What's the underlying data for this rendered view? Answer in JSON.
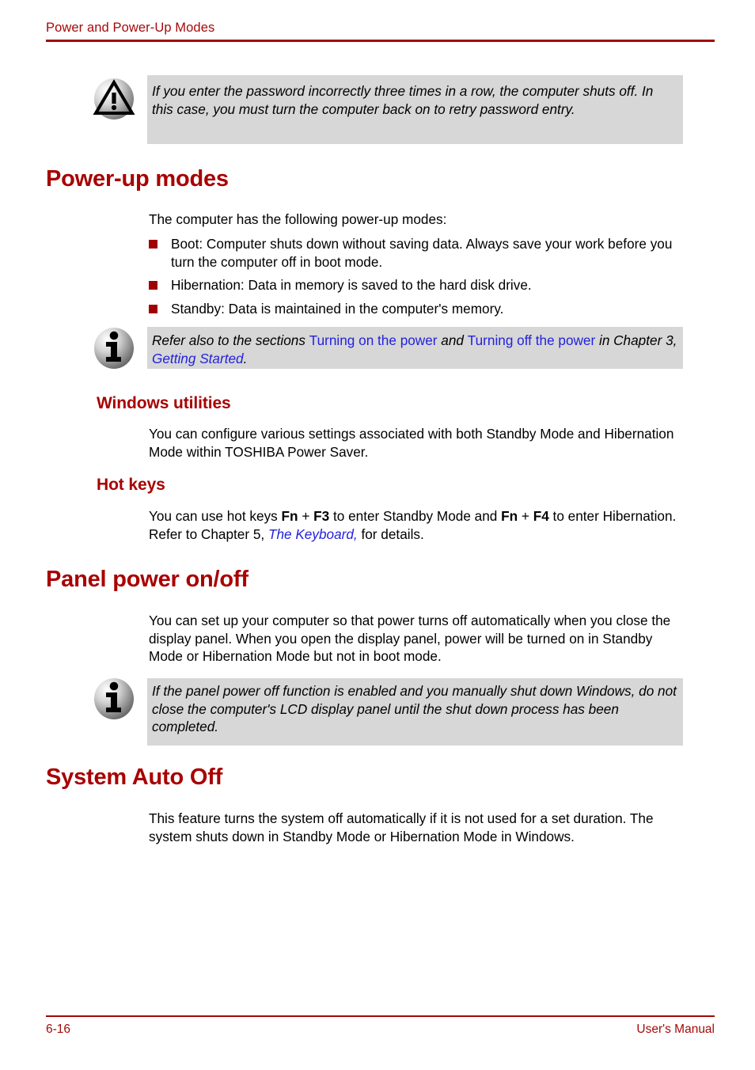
{
  "header": {
    "title": "Power and Power-Up Modes"
  },
  "footer": {
    "page_number": "6-16",
    "manual_label": "User's Manual"
  },
  "colors": {
    "accent_red": "#A80000",
    "header_red": "#A50A0A",
    "link_blue": "#2222DD",
    "callout_gray": "#D7D7D7",
    "bullet_red": "#A00000"
  },
  "callouts": {
    "password_warning": {
      "icon": "warning-triangle-icon",
      "text": "If you enter the password incorrectly three times in a row, the computer shuts off. In this case, you must turn the computer back on to retry password entry."
    },
    "refer_note": {
      "icon": "info-i-icon",
      "segment_1": "Refer also to the sections ",
      "link_1": "Turning on the power",
      "segment_2": " and ",
      "link_2": "Turning off the power",
      "segment_3": " in Chapter 3, ",
      "link_3": "Getting Started",
      "segment_4": "."
    },
    "panel_note": {
      "icon": "info-i-icon",
      "text": "If the panel power off function is enabled and you manually shut down Windows, do not close the computer's LCD display panel until the shut down process has been completed."
    }
  },
  "sections": {
    "power_up_modes": {
      "heading": "Power-up modes",
      "intro": "The computer has the following power-up modes:",
      "bullets": [
        "Boot: Computer shuts down without saving data. Always save your work before you turn the computer off in boot mode.",
        "Hibernation: Data in memory is saved to the hard disk drive.",
        "Standby: Data is maintained in the computer's memory."
      ]
    },
    "windows_utilities": {
      "heading": "Windows utilities",
      "body": "You can configure various settings associated with both Standby Mode and Hibernation Mode within TOSHIBA Power Saver."
    },
    "hot_keys": {
      "heading": "Hot keys",
      "segment_1": "You can use hot keys ",
      "key_1": "Fn",
      "segment_2": " + ",
      "key_2": "F3",
      "segment_3": " to enter Standby Mode and ",
      "key_3": "Fn",
      "segment_4": " + ",
      "key_4": "F4",
      "segment_5": " to enter Hibernation. Refer to Chapter 5, ",
      "link_1": "The Keyboard,",
      "segment_6": " for details."
    },
    "panel_power": {
      "heading": "Panel power on/off",
      "body": "You can set up your computer so that power turns off automatically when you close the display panel. When you open the display panel, power will be turned on in Standby Mode or Hibernation Mode but not in boot mode."
    },
    "system_auto_off": {
      "heading": "System Auto Off",
      "body": "This feature turns the system off automatically if it is not used for a set duration. The system shuts down in Standby Mode or Hibernation Mode in Windows."
    }
  }
}
